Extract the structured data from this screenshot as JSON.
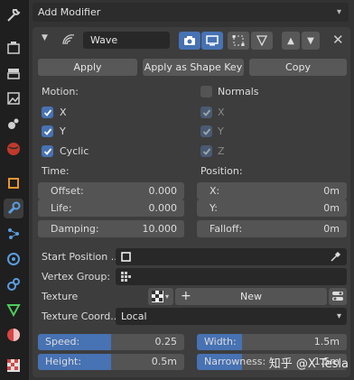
{
  "add_modifier": {
    "label": "Add Modifier"
  },
  "modifier": {
    "name": "Wave",
    "apply_label": "Apply",
    "apply_shape_label": "Apply as Shape Key",
    "copy_label": "Copy"
  },
  "motion": {
    "label": "Motion:",
    "x_label": "X",
    "x_checked": true,
    "y_label": "Y",
    "y_checked": true,
    "cyclic_label": "Cyclic",
    "cyclic_checked": true
  },
  "normals": {
    "label": "Normals",
    "checked": false,
    "x_label": "X",
    "y_label": "Y",
    "z_label": "Z"
  },
  "time": {
    "label": "Time:",
    "offset_label": "Offset:",
    "offset_value": "0.000",
    "life_label": "Life:",
    "life_value": "0.000",
    "damping_label": "Damping:",
    "damping_value": "10.000"
  },
  "position": {
    "label": "Position:",
    "x_label": "X:",
    "x_value": "0m",
    "y_label": "Y:",
    "y_value": "0m",
    "falloff_label": "Falloff:",
    "falloff_value": "0m"
  },
  "start_position": {
    "label": "Start Position ..",
    "value": ""
  },
  "vertex_group": {
    "label": "Vertex Group:",
    "value": ""
  },
  "texture": {
    "label": "Texture",
    "new_label": "New"
  },
  "texture_coords": {
    "label": "Texture Coord..",
    "value": "Local"
  },
  "speed": {
    "label": "Speed:",
    "value": "0.25",
    "fill": 0.5
  },
  "width": {
    "label": "Width:",
    "value": "1.5m",
    "fill": 0.3
  },
  "height": {
    "label": "Height:",
    "value": "0.5m",
    "fill": 0.5
  },
  "narrowness": {
    "label": "Narrowness:",
    "value": "1.5m",
    "fill": 0.3
  },
  "watermark": {
    "text": "知乎 @X Tesla"
  },
  "colors": {
    "accent": "#4772b3",
    "panel": "#3d3d3d",
    "field": "#545454"
  }
}
